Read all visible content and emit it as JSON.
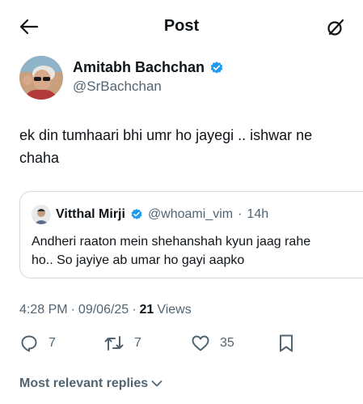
{
  "header": {
    "title": "Post",
    "back_icon": "arrow-left-icon",
    "grok_icon": "grok-icon"
  },
  "author": {
    "name": "Amitabh Bachchan",
    "handle": "@SrBachchan",
    "verified": true,
    "verified_color": "#1d9bf0"
  },
  "post": {
    "text": "ek din tumhaari bhi umr ho jayegi .. ishwar ne chaha"
  },
  "quote": {
    "name": "Vitthal Mirji",
    "handle": "@whoami_vim",
    "separator": "·",
    "time": "14h",
    "verified": true,
    "text": "Andheri raaton mein shehanshah kyun jaag rahe ho.. So jayiye ab umar ho gayi aapko"
  },
  "meta": {
    "time": "4:28 PM",
    "dot1": "·",
    "date": "09/06/25",
    "dot2": "·",
    "views_count": "21",
    "views_label": "Views"
  },
  "actions": {
    "replies": "7",
    "reposts": "7",
    "likes": "35"
  },
  "replies_sort": {
    "label": "Most relevant replies"
  },
  "colors": {
    "text": "#0f1419",
    "secondary": "#536471",
    "border": "#cfd9de",
    "accent": "#1d9bf0"
  }
}
